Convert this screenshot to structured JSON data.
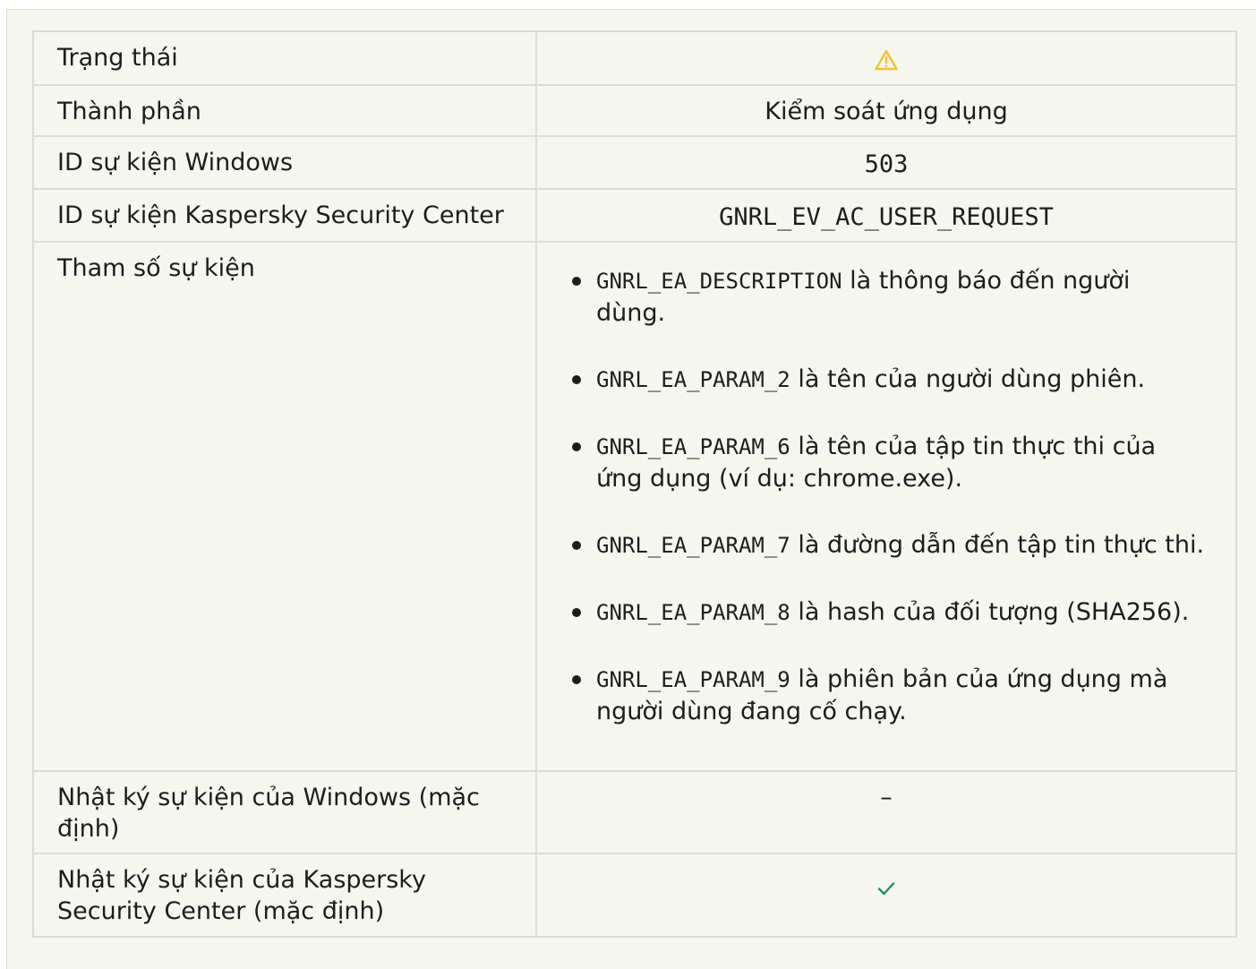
{
  "rows": {
    "status": {
      "label": "Trạng thái",
      "icon": "warning-icon",
      "icon_color": "#f2c230"
    },
    "component": {
      "label": "Thành phần",
      "value": "Kiểm soát ứng dụng"
    },
    "windows_event_id": {
      "label": "ID sự kiện Windows",
      "value": "503"
    },
    "ksc_event_id": {
      "label": "ID sự kiện Kaspersky Security Center",
      "value": "GNRL_EV_AC_USER_REQUEST"
    },
    "event_params": {
      "label": "Tham số sự kiện",
      "items": [
        {
          "code": "GNRL_EA_DESCRIPTION",
          "text": " là thông báo đến người dùng."
        },
        {
          "code": "GNRL_EA_PARAM_2",
          "text": " là tên của người dùng phiên."
        },
        {
          "code": "GNRL_EA_PARAM_6",
          "text": " là tên của tập tin thực thi của ứng dụng (ví dụ: chrome.exe)."
        },
        {
          "code": "GNRL_EA_PARAM_7",
          "text": " là đường dẫn đến tập tin thực thi."
        },
        {
          "code": "GNRL_EA_PARAM_8",
          "text": " là hash của đối tượng (SHA256)."
        },
        {
          "code": "GNRL_EA_PARAM_9",
          "text": " là phiên bản của ứng dụng mà người dùng đang cố chạy."
        }
      ]
    },
    "windows_log": {
      "label": "Nhật ký sự kiện của Windows (mặc định)",
      "value": "–"
    },
    "ksc_log": {
      "label": "Nhật ký sự kiện của Kaspersky Security Center (mặc định)",
      "icon": "checkmark-icon",
      "icon_color": "#1f8a70"
    }
  }
}
